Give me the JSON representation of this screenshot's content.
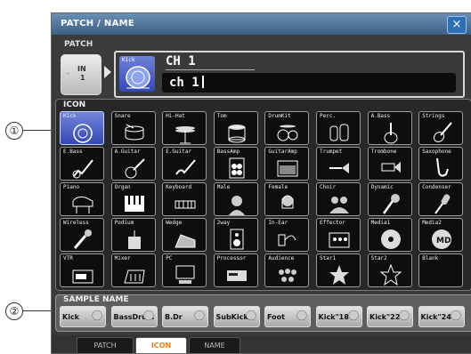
{
  "callouts": {
    "one": "①",
    "two": "②"
  },
  "window": {
    "title": "PATCH / NAME",
    "close_glyph": "×"
  },
  "patch": {
    "label": "PATCH",
    "input_label": "IN",
    "input_number": "1",
    "dash": "-"
  },
  "name": {
    "selected_icon_label": "Kick",
    "channel_id": "CH 1",
    "value": "ch 1"
  },
  "icon_panel": {
    "label": "ICON",
    "selected": "Kick",
    "icons": [
      {
        "label": "Kick",
        "icon": "bass-drum-icon"
      },
      {
        "label": "Snare",
        "icon": "snare-drum-icon"
      },
      {
        "label": "Hi-Hat",
        "icon": "hi-hat-icon"
      },
      {
        "label": "Tom",
        "icon": "tom-drum-icon"
      },
      {
        "label": "DrumKit",
        "icon": "drum-kit-icon"
      },
      {
        "label": "Perc.",
        "icon": "percussion-icon"
      },
      {
        "label": "A.Bass",
        "icon": "acoustic-bass-icon"
      },
      {
        "label": "Strings",
        "icon": "strings-icon"
      },
      {
        "label": "E.Bass",
        "icon": "electric-bass-icon"
      },
      {
        "label": "A.Guitar",
        "icon": "acoustic-guitar-icon"
      },
      {
        "label": "E.Guitar",
        "icon": "electric-guitar-icon"
      },
      {
        "label": "BassAmp",
        "icon": "bass-amp-icon"
      },
      {
        "label": "GuitarAmp",
        "icon": "guitar-amp-icon"
      },
      {
        "label": "Trumpet",
        "icon": "trumpet-icon"
      },
      {
        "label": "Trombone",
        "icon": "trombone-icon"
      },
      {
        "label": "Saxophone",
        "icon": "saxophone-icon"
      },
      {
        "label": "Piano",
        "icon": "piano-icon"
      },
      {
        "label": "Organ",
        "icon": "organ-icon"
      },
      {
        "label": "Keyboard",
        "icon": "keyboard-icon"
      },
      {
        "label": "Male",
        "icon": "male-singer-icon"
      },
      {
        "label": "Female",
        "icon": "female-singer-icon"
      },
      {
        "label": "Choir",
        "icon": "choir-icon"
      },
      {
        "label": "Dynamic",
        "icon": "dynamic-mic-icon"
      },
      {
        "label": "Condenser",
        "icon": "condenser-mic-icon"
      },
      {
        "label": "Wireless",
        "icon": "wireless-mic-icon"
      },
      {
        "label": "Podium",
        "icon": "podium-icon"
      },
      {
        "label": "Wedge",
        "icon": "wedge-monitor-icon"
      },
      {
        "label": "2way",
        "icon": "two-way-speaker-icon"
      },
      {
        "label": "In-Ear",
        "icon": "in-ear-monitor-icon"
      },
      {
        "label": "Effector",
        "icon": "effector-icon"
      },
      {
        "label": "Media1",
        "icon": "media-disc-icon"
      },
      {
        "label": "Media2",
        "icon": "media-md-icon"
      },
      {
        "label": "VTR",
        "icon": "vtr-icon"
      },
      {
        "label": "Mixer",
        "icon": "mixer-icon"
      },
      {
        "label": "PC",
        "icon": "pc-icon"
      },
      {
        "label": "Processor",
        "icon": "processor-icon"
      },
      {
        "label": "Audience",
        "icon": "audience-icon"
      },
      {
        "label": "Star1",
        "icon": "star-filled-icon"
      },
      {
        "label": "Star2",
        "icon": "star-outline-icon"
      },
      {
        "label": "Blank",
        "icon": "blank-icon"
      }
    ]
  },
  "sample_name": {
    "label": "SAMPLE NAME",
    "items": [
      "Kick",
      "BassDrum",
      "B.Dr",
      "SubKick",
      "Foot",
      "Kick\"18",
      "Kick\"22",
      "Kick\"24"
    ]
  },
  "tabs": [
    {
      "label": "PATCH",
      "active": false
    },
    {
      "label": "ICON",
      "active": true
    },
    {
      "label": "NAME",
      "active": false
    }
  ],
  "colors": {
    "accent_blue": "#3447b7",
    "tab_active_text": "#e5801a",
    "title_bar": "#4f77a0"
  }
}
